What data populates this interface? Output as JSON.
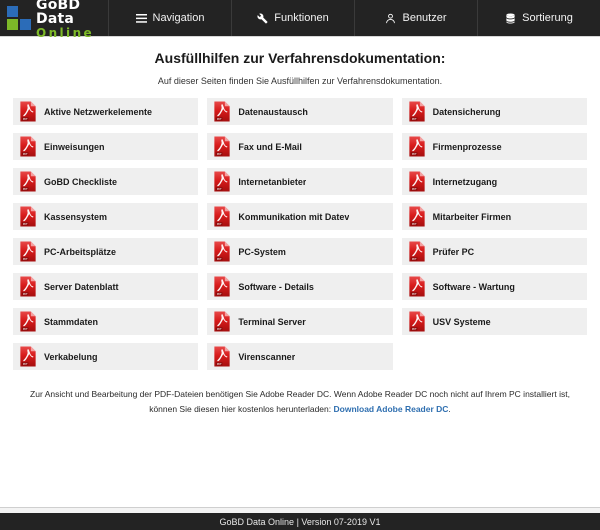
{
  "header": {
    "brand": {
      "line1": "GoBD Data",
      "line2": "Online",
      "blue": "#2b6cb8",
      "green": "#7db928"
    },
    "nav": [
      {
        "label": "Navigation",
        "icon": "hamburger-menu-icon"
      },
      {
        "label": "Funktionen",
        "icon": "wrench-icon"
      },
      {
        "label": "Benutzer",
        "icon": "user-icon"
      },
      {
        "label": "Sortierung",
        "icon": "database-stack-icon"
      }
    ]
  },
  "main": {
    "title": "Ausfüllhilfen zur Verfahrensdokumentation:",
    "subtitle": "Auf dieser Seiten finden Sie Ausfüllhilfen zur Verfahrensdokumentation.",
    "documents": [
      "Aktive Netzwerkelemente",
      "Datenaustausch",
      "Datensicherung",
      "Einweisungen",
      "Fax und E-Mail",
      "Firmenprozesse",
      "GoBD Checkliste",
      "Internetanbieter",
      "Internetzugang",
      "Kassensystem",
      "Kommunikation mit Datev",
      "Mitarbeiter Firmen",
      "PC-Arbeitsplätze",
      "PC-System",
      "Prüfer PC",
      "Server Datenblatt",
      "Software - Details",
      "Software - Wartung",
      "Stammdaten",
      "Terminal Server",
      "USV Systeme",
      "Verkabelung",
      "Virenscanner"
    ],
    "notice": {
      "text_before": "Zur Ansicht und Bearbeitung der PDF-Dateien benötigen Sie Adobe Reader DC. Wenn Adobe Reader DC noch nicht auf Ihrem PC installiert ist, können Sie diesen hier kostenlos herunterladen:",
      "link_label": "Download Adobe Reader DC",
      "text_after": ".",
      "link_color": "#2f6fb0"
    }
  },
  "footer": {
    "text": "GoBD Data Online | Version 07-2019 V1"
  },
  "theme": {
    "header_bg": "#232323",
    "card_bg": "#efefef",
    "pdf_red": "#d71b1b"
  }
}
